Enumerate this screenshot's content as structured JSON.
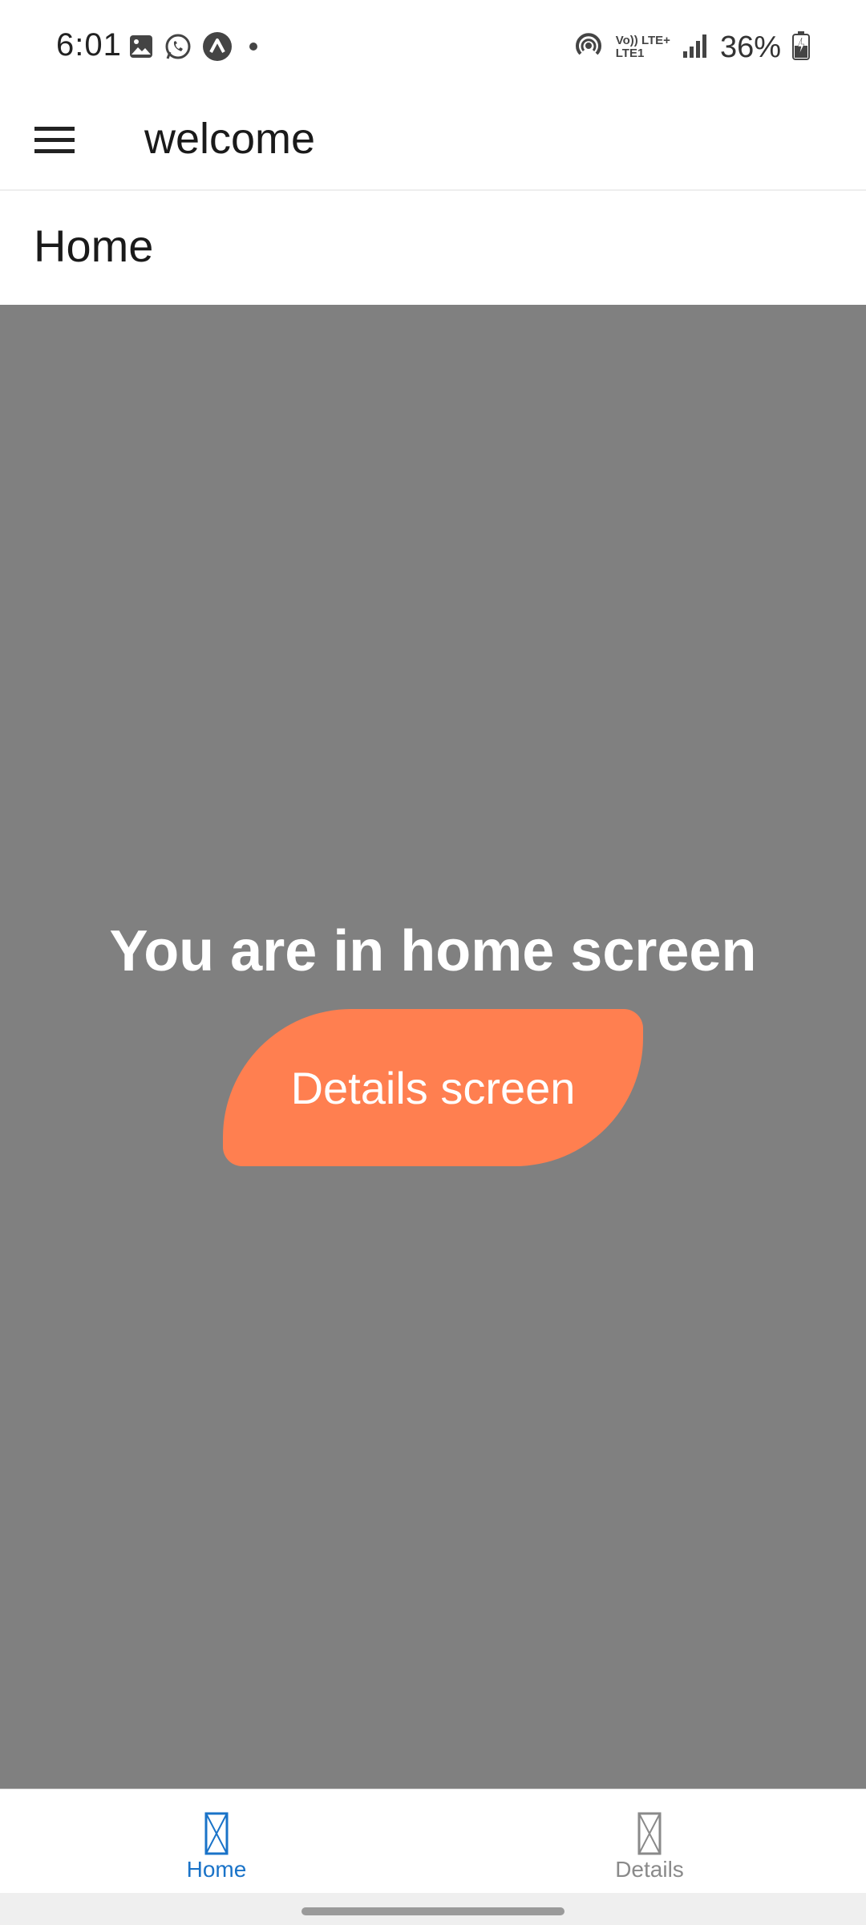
{
  "status_bar": {
    "time": "6:01",
    "battery_percent": "36%",
    "network_label_top": "Vo)) LTE+",
    "network_label_bottom": "LTE1",
    "icons": [
      "gallery-icon",
      "whatsapp-icon",
      "caret-app-icon",
      "dot-icon",
      "hotspot-icon",
      "volte-icon",
      "signal-icon",
      "battery-charging-icon"
    ]
  },
  "header": {
    "title": "welcome",
    "menu_icon": "hamburger-menu-icon"
  },
  "page": {
    "title": "Home"
  },
  "main": {
    "headline": "You are in home screen",
    "details_button_label": "Details screen",
    "background_color": "#808080",
    "button_color": "#ff7f50"
  },
  "tabs": [
    {
      "label": "Home",
      "active": true,
      "color": "#1a73c8"
    },
    {
      "label": "Details",
      "active": false,
      "color": "#8a8a8a"
    }
  ]
}
